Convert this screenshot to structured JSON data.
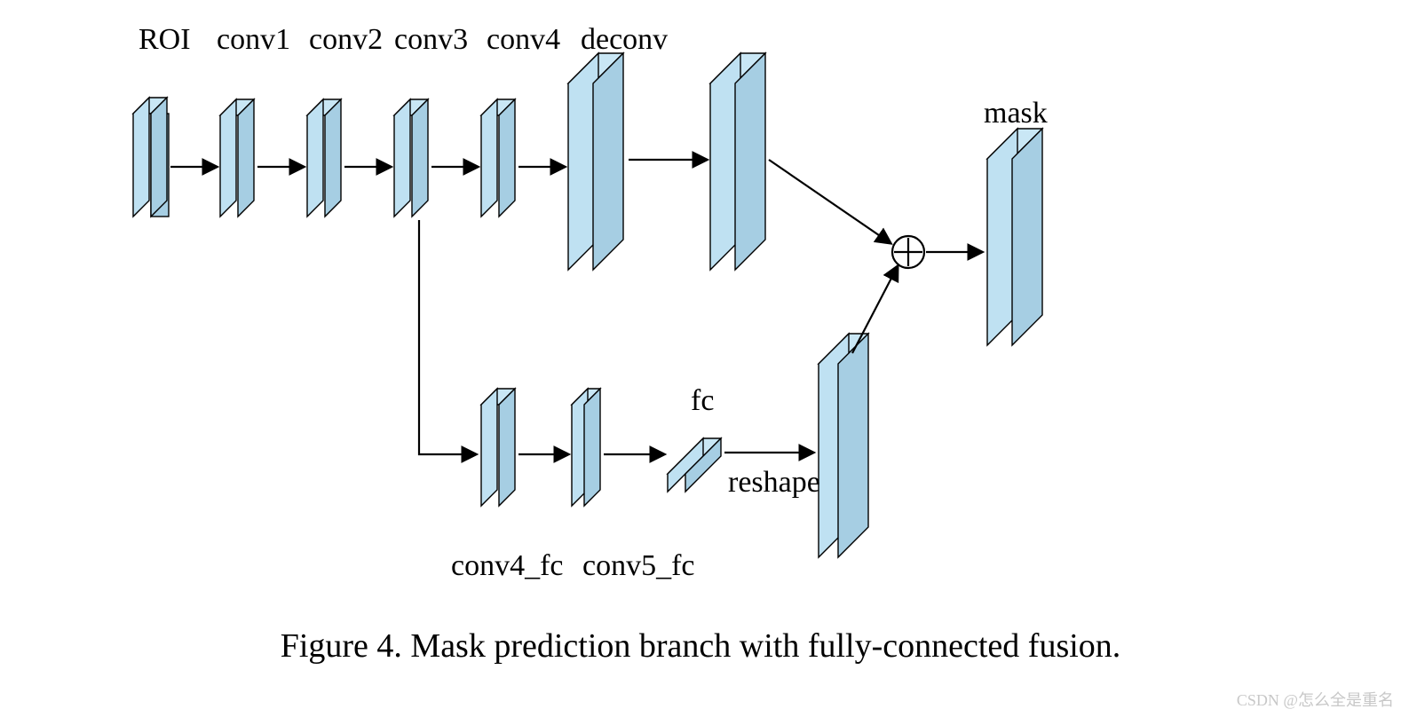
{
  "labels": {
    "roi": "ROI",
    "conv1": "conv1",
    "conv2": "conv2",
    "conv3": "conv3",
    "conv4": "conv4",
    "deconv": "deconv",
    "mask": "mask",
    "conv4_fc": "conv4_fc",
    "conv5_fc": "conv5_fc",
    "fc": "fc",
    "reshape": "reshape"
  },
  "caption": "Figure 4. Mask prediction branch with fully-connected fusion.",
  "watermark": "CSDN @怎么全是重名",
  "icons": {
    "sum": "⊕"
  }
}
